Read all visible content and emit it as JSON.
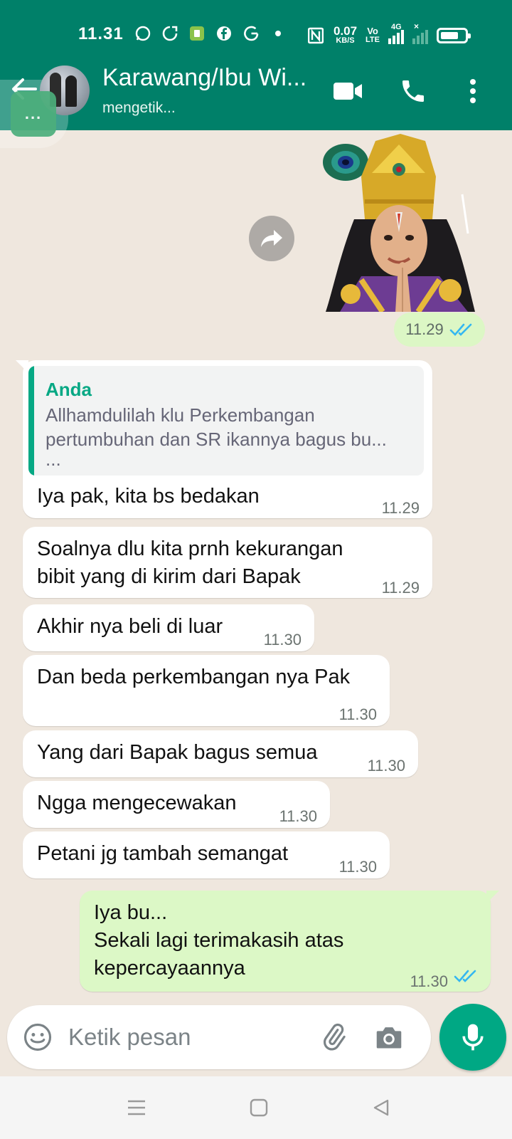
{
  "status_bar": {
    "time": "11.31",
    "net_speed_top": "0.07",
    "net_speed_bottom": "KB/S",
    "volte_top": "Vo",
    "volte_bottom": "LTE",
    "network": "4G"
  },
  "header": {
    "contact_name": "Karawang/Ibu Wi...",
    "status": "mengetik...",
    "typing_indicator": "..."
  },
  "colors": {
    "header_bg": "#008069",
    "incoming_bubble": "#ffffff",
    "outgoing_bubble": "#dcf8c6",
    "accent": "#00a884",
    "read_ticks": "#34b7f1",
    "chat_bg": "#efe7de"
  },
  "sticker": {
    "time": "11.29",
    "read": true
  },
  "messages": [
    {
      "direction": "in",
      "quote": {
        "author": "Anda",
        "line1": "Allhamdulilah klu  Perkembangan",
        "line2": "pertumbuhan dan SR ikannya bagus bu...",
        "line3": "..."
      },
      "text": "Iya pak, kita bs bedakan",
      "time": "11.29"
    },
    {
      "direction": "in",
      "line1": "Soalnya dlu kita prnh kekurangan",
      "line2": "bibit yang di kirim dari Bapak",
      "time": "11.29"
    },
    {
      "direction": "in",
      "text": "Akhir nya beli di luar",
      "time": "11.30"
    },
    {
      "direction": "in",
      "text": "Dan beda perkembangan nya Pak",
      "time": "11.30"
    },
    {
      "direction": "in",
      "text": "Yang dari Bapak bagus semua",
      "time": "11.30"
    },
    {
      "direction": "in",
      "text": "Ngga mengecewakan",
      "time": "11.30"
    },
    {
      "direction": "in",
      "text": "Petani jg tambah semangat",
      "time": "11.30"
    },
    {
      "direction": "out",
      "line1": "Iya bu...",
      "line2": "Sekali lagi terimakasih atas",
      "line3": "kepercayaannya",
      "time": "11.30",
      "read": true
    }
  ],
  "composer": {
    "placeholder": "Ketik pesan"
  },
  "icons": {
    "back": "back-arrow-icon",
    "video": "video-call-icon",
    "call": "phone-call-icon",
    "menu": "more-vert-icon",
    "forward": "forward-icon",
    "emoji": "emoji-icon",
    "attach": "paperclip-icon",
    "camera": "camera-icon",
    "mic": "mic-icon"
  }
}
